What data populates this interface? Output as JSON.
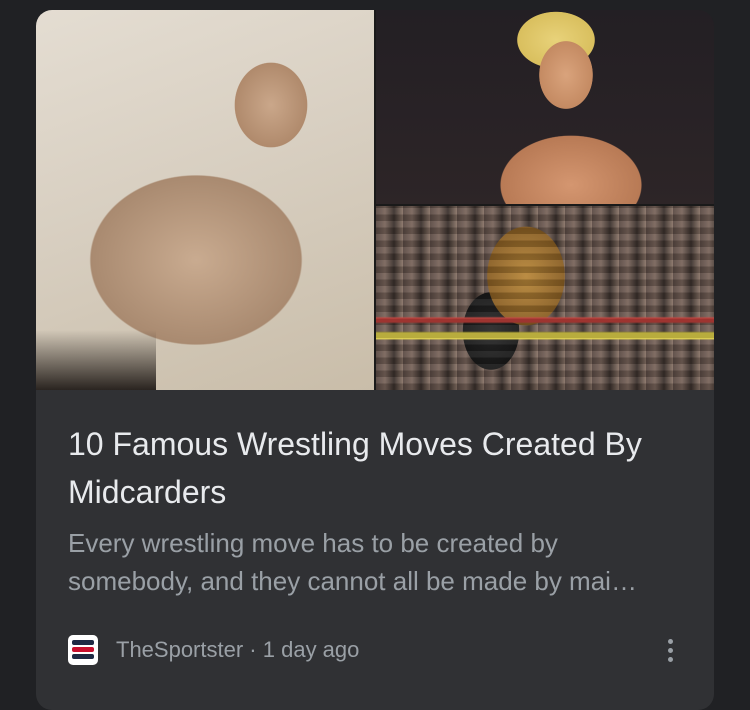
{
  "article": {
    "title": "10 Famous Wrestling Moves Created By Midcarders",
    "snippet": "Every wrestling move has to be created by somebody, and they cannot all be made by mai…",
    "source": "TheSportster",
    "separator": "·",
    "time_ago": "1 day ago"
  },
  "colors": {
    "page_background": "#202124",
    "card_background": "#303134",
    "title_text": "#e8eaed",
    "secondary_text": "#9aa0a6",
    "logo_red": "#c8102e",
    "logo_dark": "#1f2a44"
  },
  "icons": {
    "source_logo": "thesportster-logo-icon",
    "menu": "more-vert-icon"
  }
}
